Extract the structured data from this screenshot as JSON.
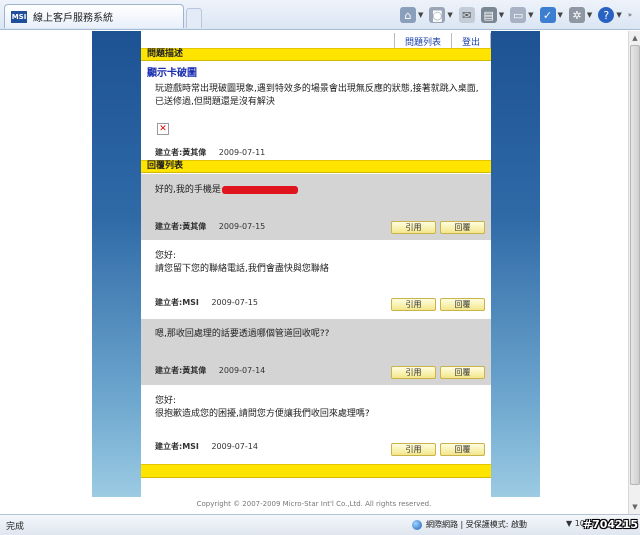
{
  "browser": {
    "tab_title": "線上客戶服務系統",
    "toolbar": [
      "home-icon",
      "feeds-icon",
      "mail-icon",
      "print-icon",
      "page-icon",
      "safety-icon",
      "tools-icon",
      "help-icon"
    ],
    "status": "完成",
    "zone": "網際網路 | 受保護模式: 啟動",
    "zoom": "▼ 100% ▼",
    "watermark": "#704215"
  },
  "page": {
    "links": {
      "issue_list": "問題列表",
      "logout": "登出"
    },
    "issue_section_title": "問題描述",
    "issue": {
      "title": "顯示卡破圖",
      "body": "玩遊戲時常出現破圖現象,遇到特效多的場景會出現無反應的狀態,接著就跳入桌面,已送修過,但問題還是沒有解決",
      "author_label": "建立者:黃其偉",
      "date": "2009-07-11"
    },
    "reply_section_title": "回覆列表",
    "replies": [
      {
        "text": "好的,我的手機是",
        "author_label": "建立者:黃其偉",
        "date": "2009-07-15",
        "quote": "引用",
        "reply": "回覆"
      },
      {
        "text_line1": "您好:",
        "text_line2": "請您留下您的聯絡電話,我們會盡快與您聯絡",
        "author_label": "建立者:MSI",
        "date": "2009-07-15",
        "quote": "引用",
        "reply": "回覆"
      },
      {
        "text": "嗯,那收回處理的話要透過哪個管道回收呢??",
        "author_label": "建立者:黃其偉",
        "date": "2009-07-14",
        "quote": "引用",
        "reply": "回覆"
      },
      {
        "text_line1": "您好:",
        "text_line2": "很抱歉造成您的困擾,請問您方便讓我們收回來處理嗎?",
        "author_label": "建立者:MSI",
        "date": "2009-07-14",
        "quote": "引用",
        "reply": "回覆"
      }
    ],
    "footer": "Copyright © 2007-2009 Micro-Star Int'l Co.,Ltd. All rights reserved."
  }
}
